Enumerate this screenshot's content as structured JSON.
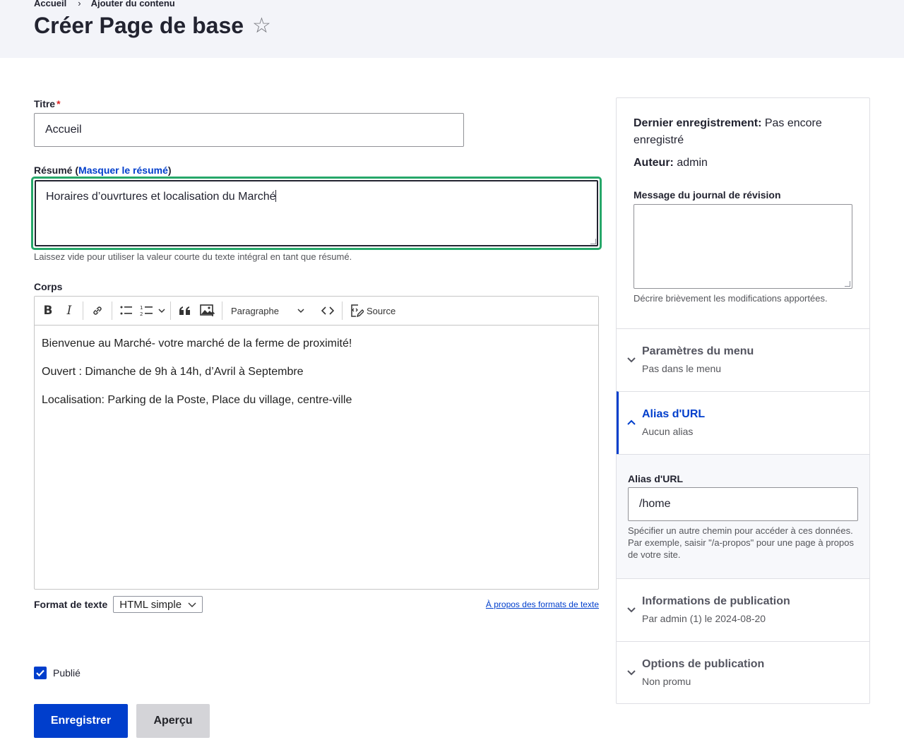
{
  "breadcrumb": {
    "home": "Accueil",
    "separator": "›",
    "current": "Ajouter du contenu"
  },
  "page": {
    "title": "Créer Page de base",
    "star": "☆"
  },
  "form": {
    "title_label": "Titre",
    "required_mark": "*",
    "title_value": "Accueil",
    "summary_label_prefix": "Résumé (",
    "summary_toggle": "Masquer le résumé",
    "summary_label_suffix": ")",
    "summary_value": "Horaires d’ouvrtures et localisation du Marché",
    "summary_help": "Laissez vide pour utiliser la valeur courte du texte intégral en tant que résumé.",
    "body_label": "Corps",
    "toolbar": {
      "bold": "B",
      "italic": "I",
      "paragraph": "Paragraphe",
      "source": "Source"
    },
    "body_paragraphs": [
      "Bienvenue au Marché- votre marché de la ferme de proximité!",
      "Ouvert : Dimanche de 9h à 14h, d’Avril à Septembre",
      "Localisation: Parking de la Poste, Place du village, centre-ville"
    ],
    "format_label": "Format de texte",
    "format_value": "HTML simple",
    "format_link": "À propos des formats de texte",
    "published_label": "Publié",
    "save_label": "Enregistrer",
    "preview_label": "Aperçu"
  },
  "sidebar": {
    "last_saved_label": "Dernier enregistrement:",
    "last_saved_value": "Pas encore enregistré",
    "author_label": "Auteur:",
    "author_value": "admin",
    "revision_label": "Message du journal de révision",
    "revision_help": "Décrire brièvement les modifications apportées.",
    "menu": {
      "title": "Paramètres du menu",
      "summary": "Pas dans le menu"
    },
    "alias": {
      "title": "Alias d'URL",
      "summary": "Aucun alias",
      "field_label": "Alias d'URL",
      "field_value": "/home",
      "help": "Spécifier un autre chemin pour accéder à ces données. Par exemple, saisir \"/a-propos\" pour une page à propos de votre site."
    },
    "publication_info": {
      "title": "Informations de publication",
      "summary": "Par admin (1) le 2024-08-20"
    },
    "publication_options": {
      "title": "Options de publication",
      "summary": "Non promu"
    }
  },
  "colors": {
    "accent": "#003ecc",
    "focus": "#26a769",
    "header_bg": "#f3f4f9",
    "required": "#dc2323"
  }
}
